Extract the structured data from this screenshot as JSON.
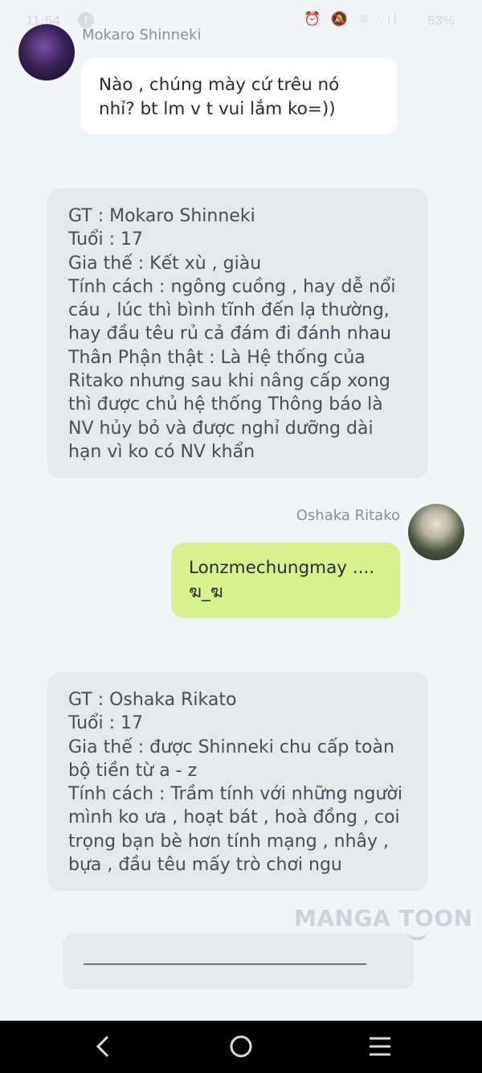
{
  "status_bar": {
    "time": "11:54",
    "alert_icon": "!",
    "icons_text": "⏰ 🔕 ≋ .ıl",
    "battery": "53%"
  },
  "messages": [
    {
      "sender": "Mokaro Shinneki",
      "side": "left",
      "avatar": "avatar-mokaro",
      "lines": [
        "Nào , chúng mày cứ trêu nó",
        "nhỉ? bt lm v t vui lắm ko=))"
      ]
    },
    {
      "sender": "Oshaka Ritako",
      "side": "right",
      "avatar": "avatar-oshaka",
      "lines": [
        "Lonzmechungmay ....",
        "ฆ_ฆ"
      ]
    }
  ],
  "profile_cards": [
    {
      "lines": [
        "GT : Mokaro  Shinneki",
        "Tuổi : 17",
        "Gia thế : Kết xù , giàu",
        "Tính cách : ngông cuồng , hay dễ nổi",
        "cáu  , lúc thì bình tĩnh đến lạ thường,",
        "hay đầu têu rủ cả đám đi đánh nhau",
        "Thân Phận thật : Là Hệ thống của",
        "Ritako nhưng sau khi nâng cấp xong",
        "thì được chủ hệ thống Thông báo là",
        "NV hủy bỏ và được nghỉ dưỡng dài",
        "hạn vì ko có NV khẩn"
      ]
    },
    {
      "lines": [
        "GT : Oshaka Rikato",
        "Tuổi : 17",
        "Gia thế : được Shinneki chu cấp toàn",
        "bộ tiền từ a - z",
        "Tính cách : Trầm tính với những người",
        "mình ko ưa , hoạt bát , hoà đồng , coi",
        "trọng bạn bè hơn tính mạng , nhây ,",
        "bựa , đầu têu mấy trò chơi ngu"
      ]
    }
  ],
  "watermark": "MANGA TOON",
  "input_box": {
    "text": "________________________________"
  },
  "nav_bar": {
    "back": "back-icon",
    "home": "home-icon",
    "menu": "menu-icon"
  },
  "colors": {
    "background": "#f2f4f7",
    "bubble_green": "#d6f28f",
    "card": "#e6e8ec"
  }
}
